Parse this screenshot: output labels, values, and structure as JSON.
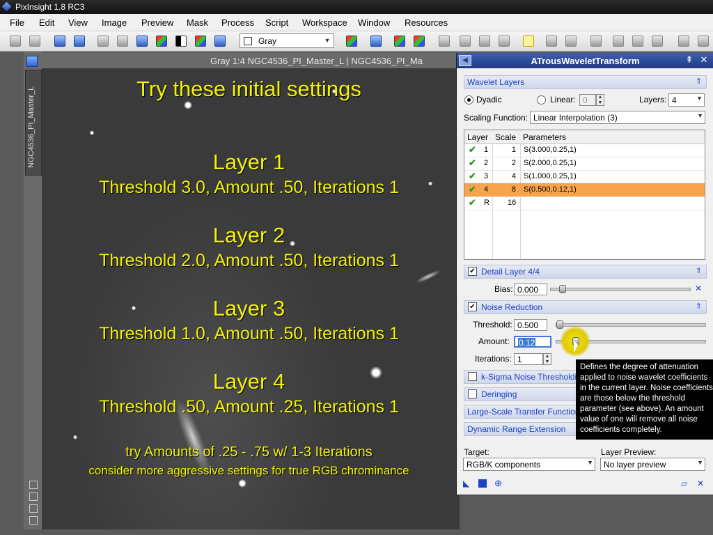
{
  "app": {
    "title": "PixInsight 1.8 RC3"
  },
  "menu": [
    "File",
    "Edit",
    "View",
    "Image",
    "Preview",
    "Mask",
    "Process",
    "Script",
    "Workspace",
    "Window",
    "Resources"
  ],
  "toolbar": {
    "color_space": "Gray"
  },
  "image_window": {
    "title": "Gray 1:4 NGC4536_PI_Master_L | NGC4536_PI_Ma",
    "side_tab": "NGC4536_PI_Master_L",
    "overlay": {
      "heading": "Try these initial settings",
      "layers": [
        {
          "name": "Layer 1",
          "settings": "Threshold 3.0, Amount .50, Iterations 1"
        },
        {
          "name": "Layer 2",
          "settings": "Threshold 2.0, Amount .50, Iterations 1"
        },
        {
          "name": "Layer 3",
          "settings": "Threshold 1.0, Amount .50, Iterations 1"
        },
        {
          "name": "Layer 4",
          "settings": "Threshold .50, Amount .25, Iterations 1"
        }
      ],
      "footer1": "try Amounts of .25 - .75 w/ 1-3 Iterations",
      "footer2": "consider more aggressive settings for true RGB chrominance"
    }
  },
  "panel": {
    "title": "ATrousWaveletTransform",
    "wavelet_layers": {
      "section": "Wavelet Layers",
      "dyadic": "Dyadic",
      "linear": "Linear:",
      "linear_value": "0",
      "layers_label": "Layers:",
      "layers_value": "4",
      "scaling_label": "Scaling Function:",
      "scaling_value": "Linear Interpolation (3)",
      "columns": [
        "Layer",
        "Scale",
        "Parameters"
      ],
      "rows": [
        {
          "layer": "1",
          "scale": "1",
          "params": "S(3.000,0.25,1)"
        },
        {
          "layer": "2",
          "scale": "2",
          "params": "S(2.000,0.25,1)"
        },
        {
          "layer": "3",
          "scale": "4",
          "params": "S(1.000,0.25,1)"
        },
        {
          "layer": "4",
          "scale": "8",
          "params": "S(0.500,0.12,1)"
        },
        {
          "layer": "R",
          "scale": "16",
          "params": ""
        }
      ],
      "selected_row": 3
    },
    "detail_layer": {
      "section": "Detail Layer 4/4",
      "bias_label": "Bias:",
      "bias_value": "0.000"
    },
    "noise_reduction": {
      "section": "Noise Reduction",
      "threshold_label": "Threshold:",
      "threshold_value": "0.500",
      "amount_label": "Amount:",
      "amount_value": "0.12",
      "iterations_label": "Iterations:",
      "iterations_value": "1"
    },
    "k_sigma": "k-Sigma Noise Thresholdi",
    "deringing": "Deringing",
    "large_scale": "Large-Scale Transfer Function",
    "dynamic_range": "Dynamic Range Extension",
    "target_label": "Target:",
    "target_value": "RGB/K components",
    "layer_preview_label": "Layer Preview:",
    "layer_preview_value": "No layer preview"
  },
  "tooltip": [
    "Defines the degree of attenuation",
    "applied to noise wavelet coefficients",
    "in the current layer. Noise coefficients",
    "are those below the threshold",
    "parameter (see above). An amount",
    "value of one will remove all noise",
    "coefficients completely."
  ],
  "colors": {
    "overlay_text": "#f2f20a",
    "selected_row": "#f7a44c",
    "section_text": "#1d44c2",
    "panel_title": "#1d3b86"
  }
}
